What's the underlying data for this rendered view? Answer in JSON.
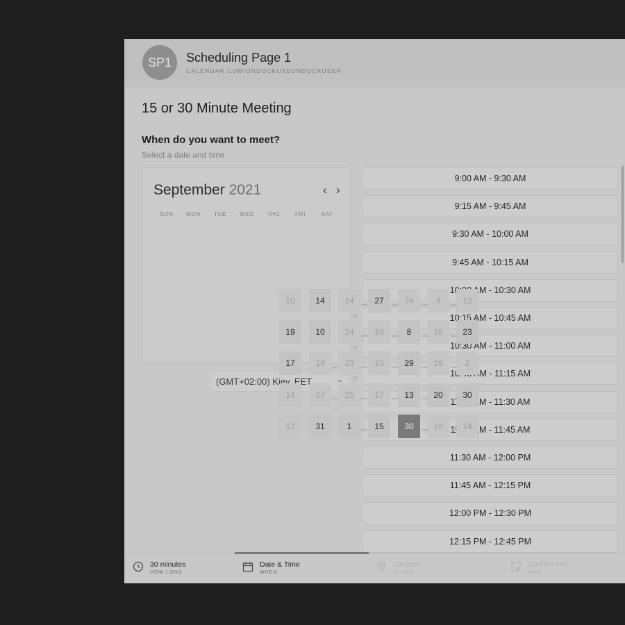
{
  "header": {
    "avatar": "SP1",
    "name": "Scheduling Page 1",
    "url": "CALENDAR.COM/UNDOCKUSEUNDOCKUSER"
  },
  "title": "15 or 30 Minute Meeting",
  "question": "When do you want to meet?",
  "subtitle": "Select a date and time",
  "calendar": {
    "month": "September",
    "year": "2021",
    "weekdays": [
      "SUN",
      "MON",
      "TUE",
      "WED",
      "THU",
      "FRI",
      "SAT"
    ],
    "days": [
      {
        "label": "10",
        "faint": true
      },
      {
        "label": "14",
        "faint": false
      },
      {
        "label": "14",
        "faint": true
      },
      {
        "label": "27",
        "faint": false
      },
      {
        "label": "24",
        "faint": true
      },
      {
        "label": "4",
        "faint": true
      },
      {
        "label": "12",
        "faint": true
      },
      {
        "label": "19",
        "faint": false
      },
      {
        "label": "10",
        "faint": false
      },
      {
        "label": "24",
        "faint": true
      },
      {
        "label": "10",
        "faint": true
      },
      {
        "label": "8",
        "faint": false
      },
      {
        "label": "18",
        "faint": true
      },
      {
        "label": "23",
        "faint": false
      },
      {
        "label": "17",
        "faint": false
      },
      {
        "label": "14",
        "faint": true
      },
      {
        "label": "23",
        "faint": true
      },
      {
        "label": "13",
        "faint": true
      },
      {
        "label": "29",
        "faint": false
      },
      {
        "label": "19",
        "faint": true
      },
      {
        "label": "2",
        "faint": true
      },
      {
        "label": "14",
        "faint": true
      },
      {
        "label": "27",
        "faint": true
      },
      {
        "label": "25",
        "faint": true
      },
      {
        "label": "17",
        "faint": true
      },
      {
        "label": "13",
        "faint": false
      },
      {
        "label": "20",
        "faint": false
      },
      {
        "label": "30",
        "faint": false
      },
      {
        "label": "13",
        "faint": true
      },
      {
        "label": "31",
        "faint": false
      },
      {
        "label": "1",
        "faint": false
      },
      {
        "label": "15",
        "faint": false
      },
      {
        "label": "30",
        "selected": true
      },
      {
        "label": "19",
        "faint": true
      },
      {
        "label": "14",
        "faint": true
      }
    ],
    "prev_icon": "chevron-left-icon",
    "next_icon": "chevron-right-icon"
  },
  "timezone": {
    "value": "(GMT+02:00) Kiev, EET"
  },
  "slots": [
    "9:00 AM - 9:30 AM",
    "9:15 AM - 9:45 AM",
    "9:30 AM - 10:00 AM",
    "9:45 AM - 10:15 AM",
    "10:00 AM - 10:30 AM",
    "10:15 AM - 10:45 AM",
    "10:30 AM - 11:00 AM",
    "10:45 AM - 11:15 AM",
    "11:00 AM - 11:30 AM",
    "11:15 AM - 11:45 AM",
    "11:30 AM - 12:00 PM",
    "11:45 AM - 12:15 PM",
    "12:00 PM - 12:30 PM",
    "12:15 PM - 12:45 PM"
  ],
  "steps": [
    {
      "label": "30 minutes",
      "caption": "HOW LONG",
      "icon": "clock-icon"
    },
    {
      "label": "Date & Time",
      "caption": "WHEN",
      "icon": "calendar-icon"
    },
    {
      "label": "Location",
      "caption": "WHERE",
      "icon": "location-pin-icon"
    },
    {
      "label": "Confirm info",
      "caption": "WHO",
      "icon": "note-icon"
    }
  ],
  "progress_step": 2,
  "colors": {
    "overlay": "#1e1e1e",
    "selected": "#7a7a7a"
  }
}
